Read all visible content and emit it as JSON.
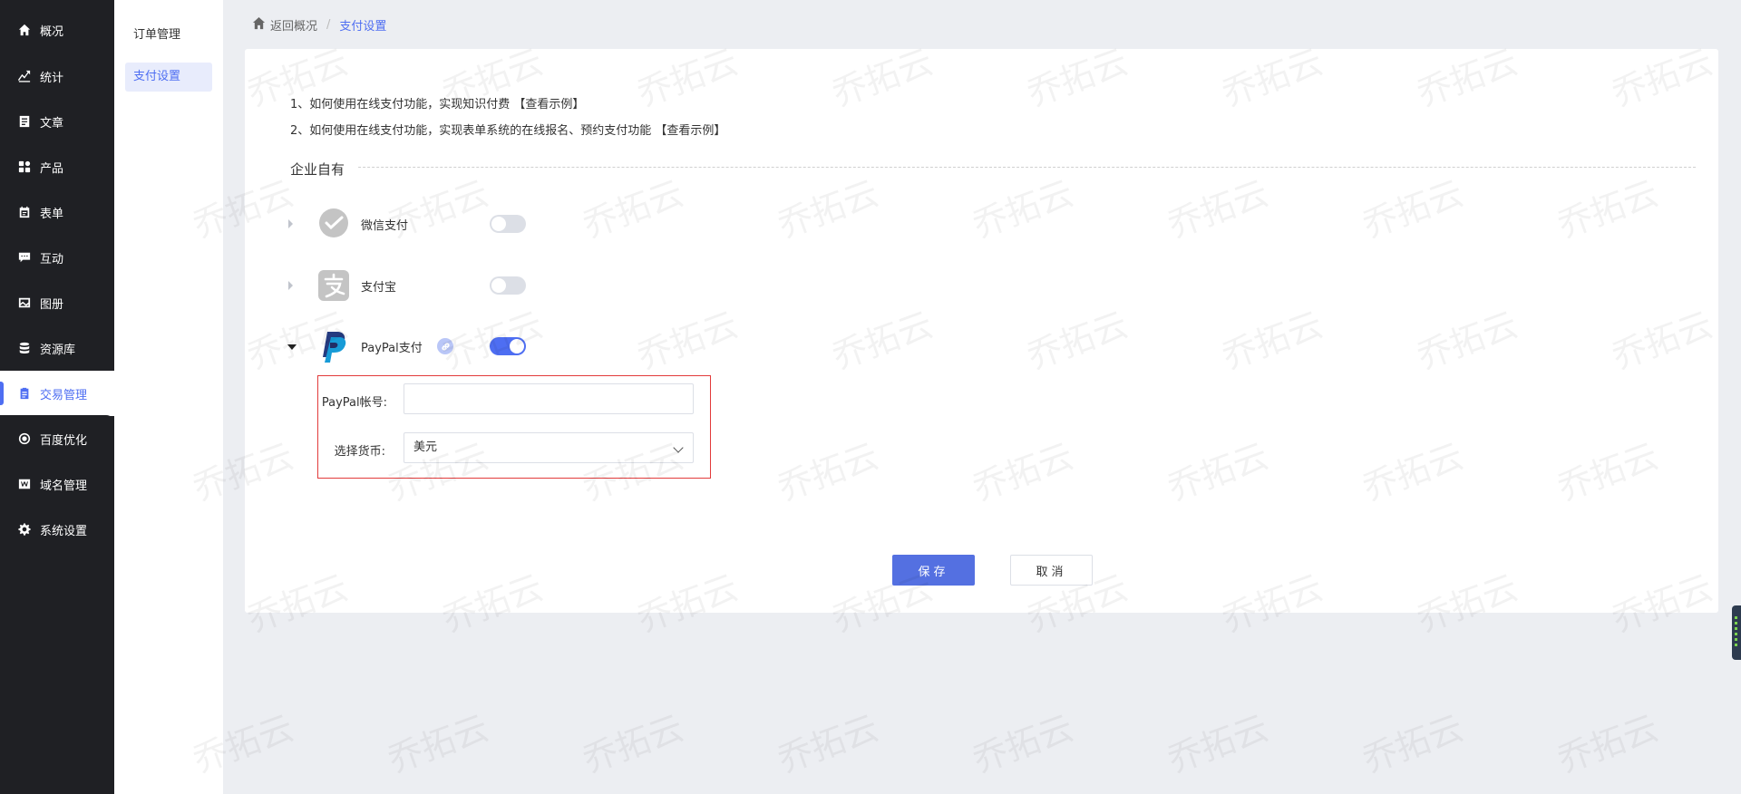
{
  "nav": {
    "items": [
      {
        "label": "概况",
        "icon": "home-icon"
      },
      {
        "label": "统计",
        "icon": "stats-icon"
      },
      {
        "label": "文章",
        "icon": "article-icon"
      },
      {
        "label": "产品",
        "icon": "product-icon"
      },
      {
        "label": "表单",
        "icon": "form-icon"
      },
      {
        "label": "互动",
        "icon": "chat-icon"
      },
      {
        "label": "图册",
        "icon": "gallery-icon"
      },
      {
        "label": "资源库",
        "icon": "database-icon"
      },
      {
        "label": "交易管理",
        "icon": "clipboard-icon",
        "active": true
      },
      {
        "label": "百度优化",
        "icon": "seo-icon"
      },
      {
        "label": "域名管理",
        "icon": "domain-icon"
      },
      {
        "label": "系统设置",
        "icon": "gear-icon"
      }
    ]
  },
  "submenu": {
    "items": [
      {
        "label": "订单管理"
      },
      {
        "label": "支付设置",
        "active": true
      }
    ]
  },
  "breadcrumb": {
    "back": "返回概况",
    "separator": "/",
    "current": "支付设置"
  },
  "tips": [
    {
      "text": "1、如何使用在线支付功能，实现知识付费",
      "link": "【查看示例】"
    },
    {
      "text": "2、如何使用在线支付功能，实现表单系统的在线报名、预约支付功能",
      "link": "【查看示例】"
    }
  ],
  "section": {
    "title": "企业自有"
  },
  "payments": [
    {
      "name": "微信支付",
      "icon": "wechat-pay-icon",
      "enabled": false,
      "expanded": false
    },
    {
      "name": "支付宝",
      "icon": "alipay-icon",
      "enabled": false,
      "expanded": false
    },
    {
      "name": "PayPal支付",
      "icon": "paypal-icon",
      "enabled": true,
      "expanded": true
    }
  ],
  "paypal_form": {
    "account_label": "PayPal帐号:",
    "account_value": "",
    "currency_label": "选择货币:",
    "currency_value": "美元"
  },
  "actions": {
    "save": "保存",
    "cancel": "取消"
  },
  "watermark": "乔拓云",
  "colors": {
    "accent": "#4e6ef2",
    "nav_bg": "#1f2024",
    "highlight_border": "#e23b3b"
  }
}
